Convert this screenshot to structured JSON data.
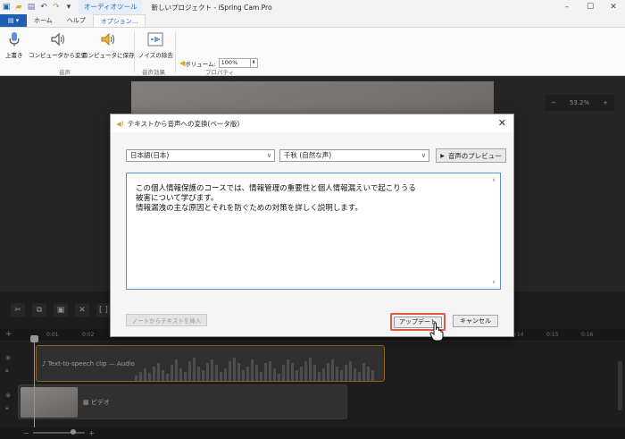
{
  "window": {
    "title": "新しいプロジェクト - iSpring Cam Pro",
    "context_tab": "オーディオツール"
  },
  "tabs": {
    "file": "",
    "home": "ホーム",
    "help": "ヘルプ",
    "options": "オプション..."
  },
  "ribbon": {
    "buttons": {
      "overwrite": "上書き",
      "change_from_computer": "コンピュータから変更",
      "save_to_computer": "コンピュータに保存",
      "noise_removal": "ノイズの除去"
    },
    "groups": {
      "audio": "音声",
      "sound_effects": "音声効果",
      "properties": "プロパティ"
    },
    "volume": {
      "label": "ボリューム:",
      "value": "100%"
    }
  },
  "preview": {
    "zoom": "53.2%"
  },
  "dialog": {
    "title": "テキストから音声への変換(ベータ版)",
    "language": "日本語(日本)",
    "voice": "千秋 (自然な声)",
    "preview_button": "音声のプレビュー",
    "text_lines": [
      "この個人情報保護のコースでは、情報管理の重要性と個人情報漏えいで起こりうる",
      "被害について学びます。",
      "情報漏洩の主な原因とそれを防ぐための対策を詳しく説明します。"
    ],
    "insert_from_notes": "ノートからテキストを挿入",
    "update_button": "アップデート",
    "cancel_button": "キャンセル"
  },
  "timeline": {
    "ruler": [
      "0:01",
      "0:02",
      "0:14",
      "0:15",
      "0:16"
    ],
    "audio_clip_label": "Text-to-speech clip — Audio",
    "video_clip_label": "ビデオ"
  },
  "colors": {
    "accent": "#1f5fb0",
    "highlight": "#e35a45",
    "audio_clip_border": "#d79a2d"
  }
}
